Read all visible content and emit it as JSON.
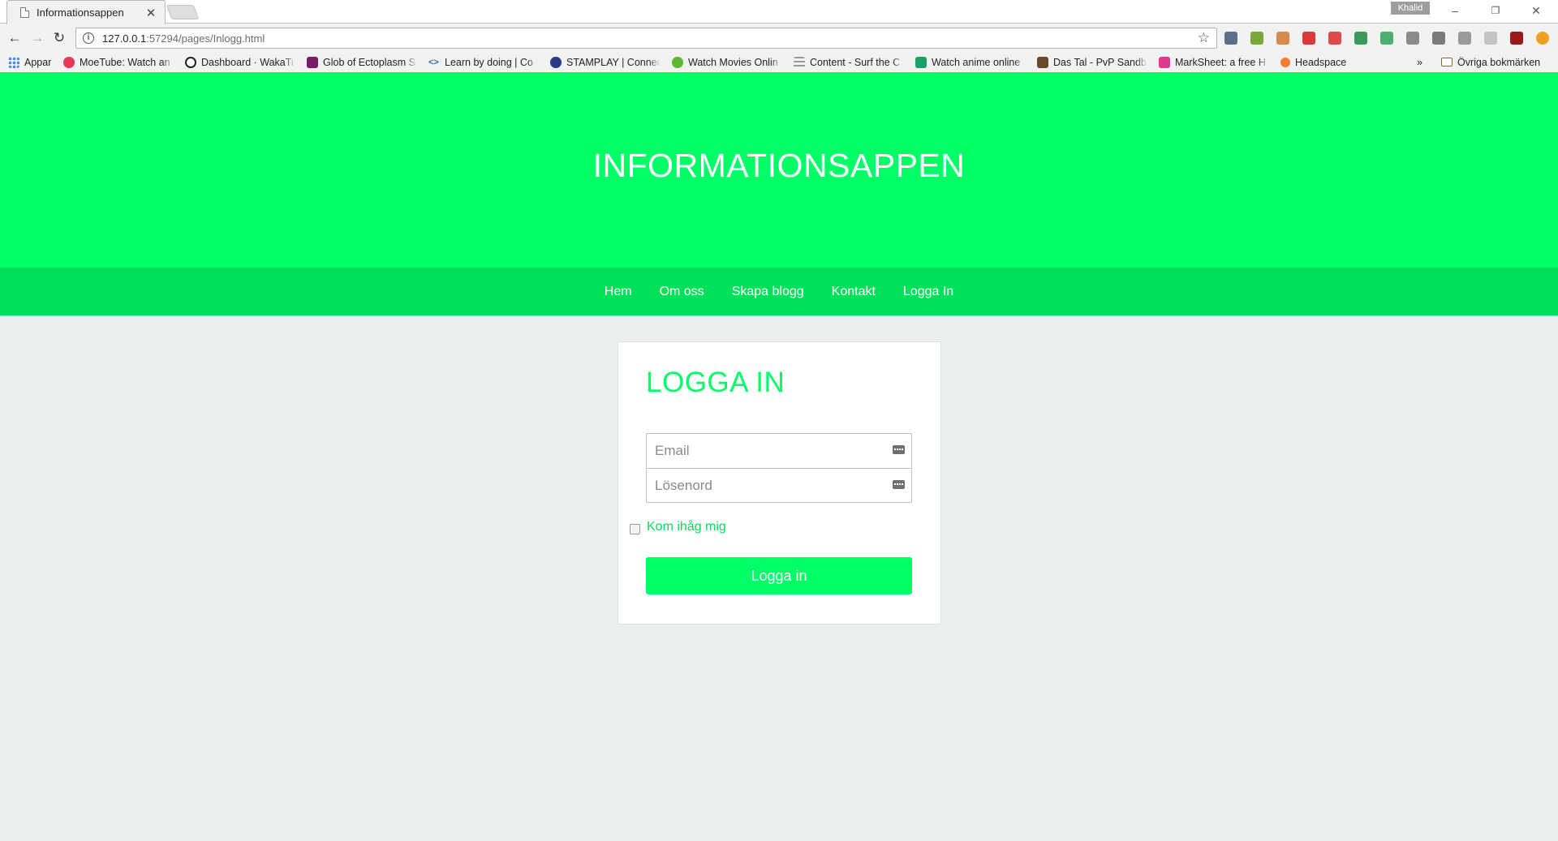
{
  "browser": {
    "tab_title": "Informationsappen",
    "tab_close": "✕",
    "profile_name": "Khalid",
    "window_controls": [
      "–",
      "❐",
      "✕"
    ],
    "url_host": "127.0.0.1",
    "url_rest": ":57294/pages/Inlogg.html",
    "bookmarks": [
      {
        "label": "Appar",
        "icon": "apps-grid-icon",
        "color": "#4285f4"
      },
      {
        "label": "MoeTube: Watch an",
        "icon": "moetube-icon",
        "color": "#e8375a"
      },
      {
        "label": "Dashboard · WakaTi",
        "icon": "wakatime-icon",
        "color": "#222222"
      },
      {
        "label": "Glob of Ectoplasm S",
        "icon": "ectoplasm-icon",
        "color": "#7a1a6a"
      },
      {
        "label": "Learn by doing | Co",
        "icon": "code-icon",
        "color": "#2a6fb5"
      },
      {
        "label": "STAMPLAY | Connec",
        "icon": "stamplay-icon",
        "color": "#2a3a8a"
      },
      {
        "label": "Watch Movies Onlin",
        "icon": "play-icon",
        "color": "#5cb82e"
      },
      {
        "label": "Content - Surf the C",
        "icon": "content-icon",
        "color": "#9a9a9a"
      },
      {
        "label": "Watch anime online",
        "icon": "anime-icon",
        "color": "#1aa064"
      },
      {
        "label": "Das Tal - PvP Sandb",
        "icon": "dastal-icon",
        "color": "#6b4a2a"
      },
      {
        "label": "MarkSheet: a free H",
        "icon": "marksheet-icon",
        "color": "#e0388a"
      },
      {
        "label": "Headspace",
        "icon": "headspace-icon",
        "color": "#f47d30"
      }
    ],
    "overflow_chevron": "»",
    "other_bookmarks": "Övriga bokmärken"
  },
  "page": {
    "site_title": "INFORMATIONSAPPEN",
    "nav": [
      "Hem",
      "Om oss",
      "Skapa blogg",
      "Kontakt",
      "Logga In"
    ],
    "login": {
      "heading": "LOGGA IN",
      "email_placeholder": "Email",
      "password_placeholder": "Lösenord",
      "remember_label": "Kom ihåg mig",
      "submit_label": "Logga in"
    }
  },
  "colors": {
    "brand_green": "#00ff66",
    "nav_green": "#00e05b",
    "page_bg": "#ecefef"
  }
}
